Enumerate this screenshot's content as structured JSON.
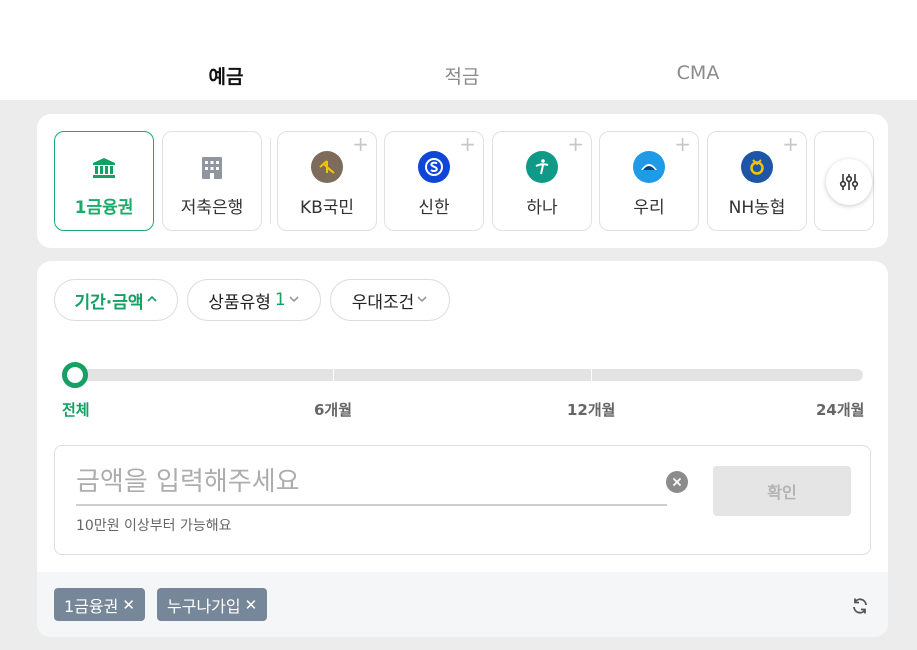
{
  "tabs": [
    {
      "label": "예금",
      "active": true
    },
    {
      "label": "적금",
      "active": false
    },
    {
      "label": "CMA",
      "active": false
    }
  ],
  "banks": {
    "groups": [
      {
        "label": "1금융권",
        "icon": "bank-building-icon",
        "active": true
      },
      {
        "label": "저축은행",
        "icon": "office-building-icon",
        "active": false
      }
    ],
    "items": [
      {
        "label": "KB국민",
        "icon": "kb-logo-icon",
        "color": "#7d6b5c"
      },
      {
        "label": "신한",
        "icon": "shinhan-logo-icon",
        "color": "#0f46d8"
      },
      {
        "label": "하나",
        "icon": "hana-logo-icon",
        "color": "#0f9a87"
      },
      {
        "label": "우리",
        "icon": "woori-logo-icon",
        "color": "#1f9ae6"
      },
      {
        "label": "NH농협",
        "icon": "nh-logo-icon",
        "color": "#1d56a6"
      }
    ],
    "add_symbol": "+"
  },
  "chips": [
    {
      "label": "기간·금액",
      "count": "",
      "active": true,
      "chevron": "^"
    },
    {
      "label": "상품유형",
      "count": "1",
      "active": false,
      "chevron": "v"
    },
    {
      "label": "우대조건",
      "count": "",
      "active": false,
      "chevron": "v"
    }
  ],
  "slider": {
    "labels": [
      "전체",
      "6개월",
      "12개월",
      "24개월"
    ],
    "selected_index": 0
  },
  "amount": {
    "placeholder": "금액을 입력해주세요",
    "value": "",
    "hint": "10만원 이상부터 가능해요",
    "confirm_label": "확인"
  },
  "tags": [
    {
      "label": "1금융권"
    },
    {
      "label": "누구나가입"
    }
  ],
  "colors": {
    "accent": "#16a063",
    "tag_bg": "#76879a"
  }
}
